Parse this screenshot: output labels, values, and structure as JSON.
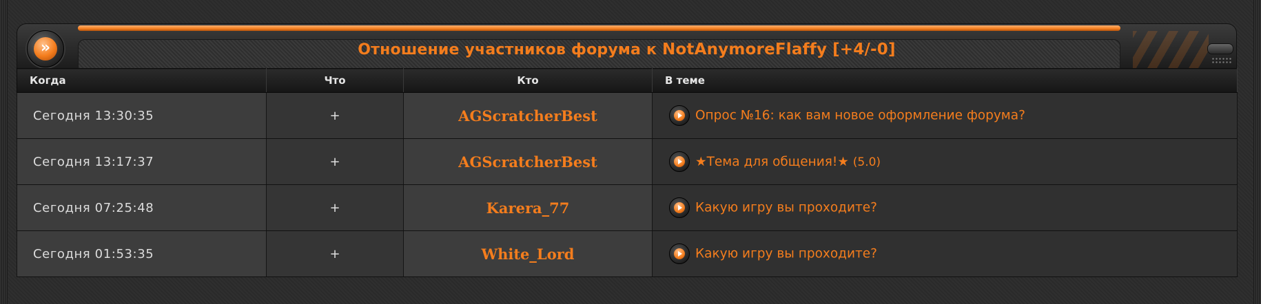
{
  "header": {
    "title_prefix": "Отношение участников форума к",
    "username": "NotAnymoreFlaffy",
    "score": "[+4/-0]",
    "badge_icon": "double-chevron-right-icon"
  },
  "colors": {
    "accent": "#f47d1d",
    "background": "#2c2c2c"
  },
  "table": {
    "columns": {
      "when": "Когда",
      "what": "Что",
      "who": "Кто",
      "topic": "В теме"
    },
    "rows": [
      {
        "when": "Сегодня 13:30:35",
        "what": "+",
        "who": "AGScratcherBest",
        "topic": "Опрос №16: как вам новое оформление форума?",
        "topic_suffix": ""
      },
      {
        "when": "Сегодня 13:17:37",
        "what": "+",
        "who": "AGScratcherBest",
        "topic": "★Тема для общения!★",
        "topic_suffix": "(5.0)"
      },
      {
        "when": "Сегодня 07:25:48",
        "what": "+",
        "who": "Karera_77",
        "topic": "Какую игру вы проходите?",
        "topic_suffix": ""
      },
      {
        "when": "Сегодня 01:53:35",
        "what": "+",
        "who": "White_Lord",
        "topic": "Какую игру вы проходите?",
        "topic_suffix": ""
      }
    ]
  }
}
